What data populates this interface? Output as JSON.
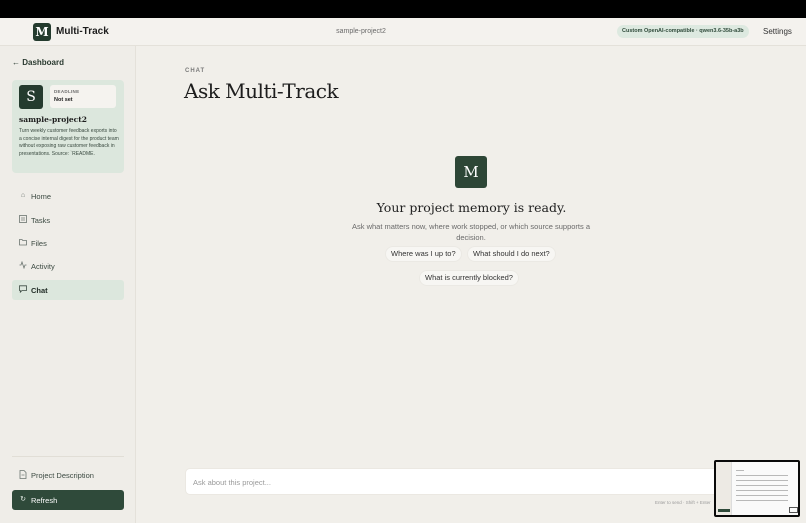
{
  "header": {
    "logo_letter": "M",
    "app_title": "Multi-Track",
    "project_name": "sample-project2",
    "model_badge": "Custom OpenAI-compatible · qwen3.6-35b-a3b",
    "settings_label": "Settings"
  },
  "sidebar": {
    "back_label": "← Dashboard",
    "project_card": {
      "avatar_letter": "S",
      "deadline_label": "DEADLINE",
      "deadline_value": "Not set",
      "title": "sample-project2",
      "description": "Turn weekly customer feedback exports into a concise internal digest for the product team without exposing raw customer feedback in presentations. Source: `README."
    },
    "items": [
      {
        "label": "Home",
        "icon": "home-icon",
        "active": false
      },
      {
        "label": "Tasks",
        "icon": "tasks-icon",
        "active": false
      },
      {
        "label": "Files",
        "icon": "folder-icon",
        "active": false
      },
      {
        "label": "Activity",
        "icon": "activity-icon",
        "active": false
      },
      {
        "label": "Chat",
        "icon": "chat-icon",
        "active": true
      }
    ],
    "footer": {
      "project_description_label": "Project Description",
      "refresh_label": "Refresh"
    }
  },
  "main": {
    "eyebrow": "CHAT",
    "title": "Ask Multi-Track",
    "empty_state": {
      "logo_letter": "M",
      "title": "Your project memory is ready.",
      "description": "Ask what matters now, where work stopped, or which source supports a decision.",
      "suggestions": [
        "Where was I up to?",
        "What should I do next?",
        "What is currently blocked?"
      ]
    },
    "input": {
      "placeholder": "Ask about this project...",
      "value": "",
      "hint": "Enter to send · Shift + Enter"
    }
  },
  "colors": {
    "brand_dark": "#243b2e",
    "active_bg": "#dce7dd",
    "page_bg": "#f1efea"
  }
}
